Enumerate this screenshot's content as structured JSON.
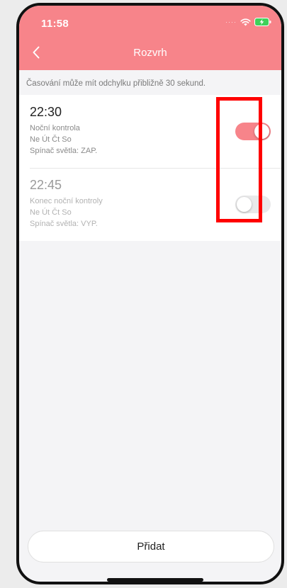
{
  "status_bar": {
    "time": "11:58",
    "signal_icon": "signal-dots-icon",
    "wifi_icon": "wifi-icon",
    "battery_icon": "battery-charging-icon"
  },
  "header": {
    "title": "Rozvrh",
    "back_icon": "chevron-left-icon",
    "background_color": "#f7848a"
  },
  "notice": "Časování může mít odchylku přibližně 30 sekund.",
  "schedules": [
    {
      "time": "22:30",
      "name": "Noční kontrola",
      "days": "Ne Út Čt So",
      "action": "Spínač světla: ZAP.",
      "enabled": true
    },
    {
      "time": "22:45",
      "name": "Konec noční kontroly",
      "days": "Ne Út Čt So",
      "action": "Spínač světla: VYP.",
      "enabled": false
    }
  ],
  "add_button": {
    "label": "Přidat"
  },
  "colors": {
    "accent": "#f7848a",
    "highlight": "#ff0000"
  }
}
